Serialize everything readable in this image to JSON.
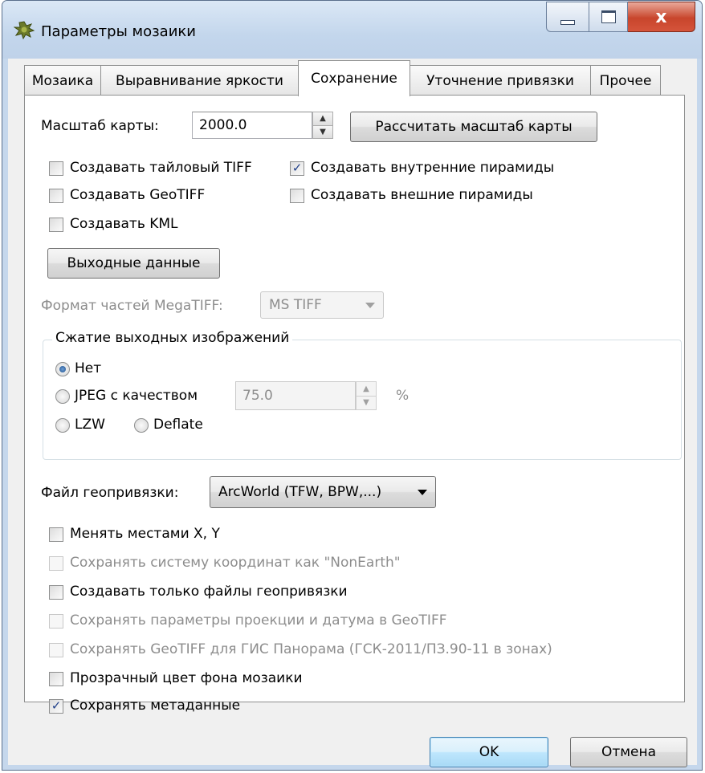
{
  "window": {
    "title": "Параметры мозаики",
    "icon": "mosaic-app-icon",
    "close_glyph": "x"
  },
  "tabs": [
    {
      "label": "Мозаика",
      "active": false
    },
    {
      "label": "Выравнивание яркости",
      "active": false
    },
    {
      "label": "Сохранение",
      "active": true
    },
    {
      "label": "Уточнение привязки",
      "active": false
    },
    {
      "label": "Прочее",
      "active": false
    }
  ],
  "scale": {
    "label": "Масштаб карты:",
    "value": "2000.0",
    "calc_button": "Рассчитать масштаб карты"
  },
  "options_top": {
    "tiled_tiff": {
      "label": "Создавать тайловый TIFF",
      "checked": false
    },
    "internal_pyramids": {
      "label": "Создавать внутренние пирамиды",
      "checked": true
    },
    "geotiff": {
      "label": "Создавать GeoTIFF",
      "checked": false
    },
    "external_pyramids": {
      "label": "Создавать внешние пирамиды",
      "checked": false
    },
    "kml": {
      "label": "Создавать KML",
      "checked": false
    }
  },
  "output_button": "Выходные данные",
  "megatiff": {
    "label": "Формат частей MegaTIFF:",
    "value": "MS TIFF"
  },
  "compression": {
    "title": "Сжатие выходных изображений",
    "none": "Нет",
    "jpeg": "JPEG с качеством",
    "jpeg_quality": "75.0",
    "percent": "%",
    "lzw": "LZW",
    "deflate": "Deflate",
    "selected": "none"
  },
  "georef": {
    "label": "Файл геопривязки:",
    "value": "ArcWorld (TFW, BPW,...)"
  },
  "options_bottom": {
    "swap_xy": {
      "label": "Менять местами X, Y",
      "checked": false
    },
    "non_earth": {
      "label": "Сохранять систему координат как \"NonEarth\"",
      "checked": false
    },
    "only_georef": {
      "label": "Создавать только файлы геопривязки",
      "checked": false
    },
    "proj_params": {
      "label": "Сохранять параметры проекции и датума в GeoTIFF",
      "checked": false
    },
    "panorama": {
      "label": "Сохранять GeoTIFF для ГИС Панорама (ГСК-2011/ПЗ.90-11 в зонах)",
      "checked": false
    },
    "transparent_bg": {
      "label": "Прозрачный цвет фона мозаики",
      "checked": false
    },
    "metadata": {
      "label": "Сохранять метаданные",
      "checked": true
    }
  },
  "footer": {
    "ok": "OK",
    "cancel": "Отмена"
  },
  "colors": {
    "frame": "#c5d7ec",
    "client": "#f0f0f0",
    "pane": "#ffffff",
    "check": "#21408a"
  }
}
